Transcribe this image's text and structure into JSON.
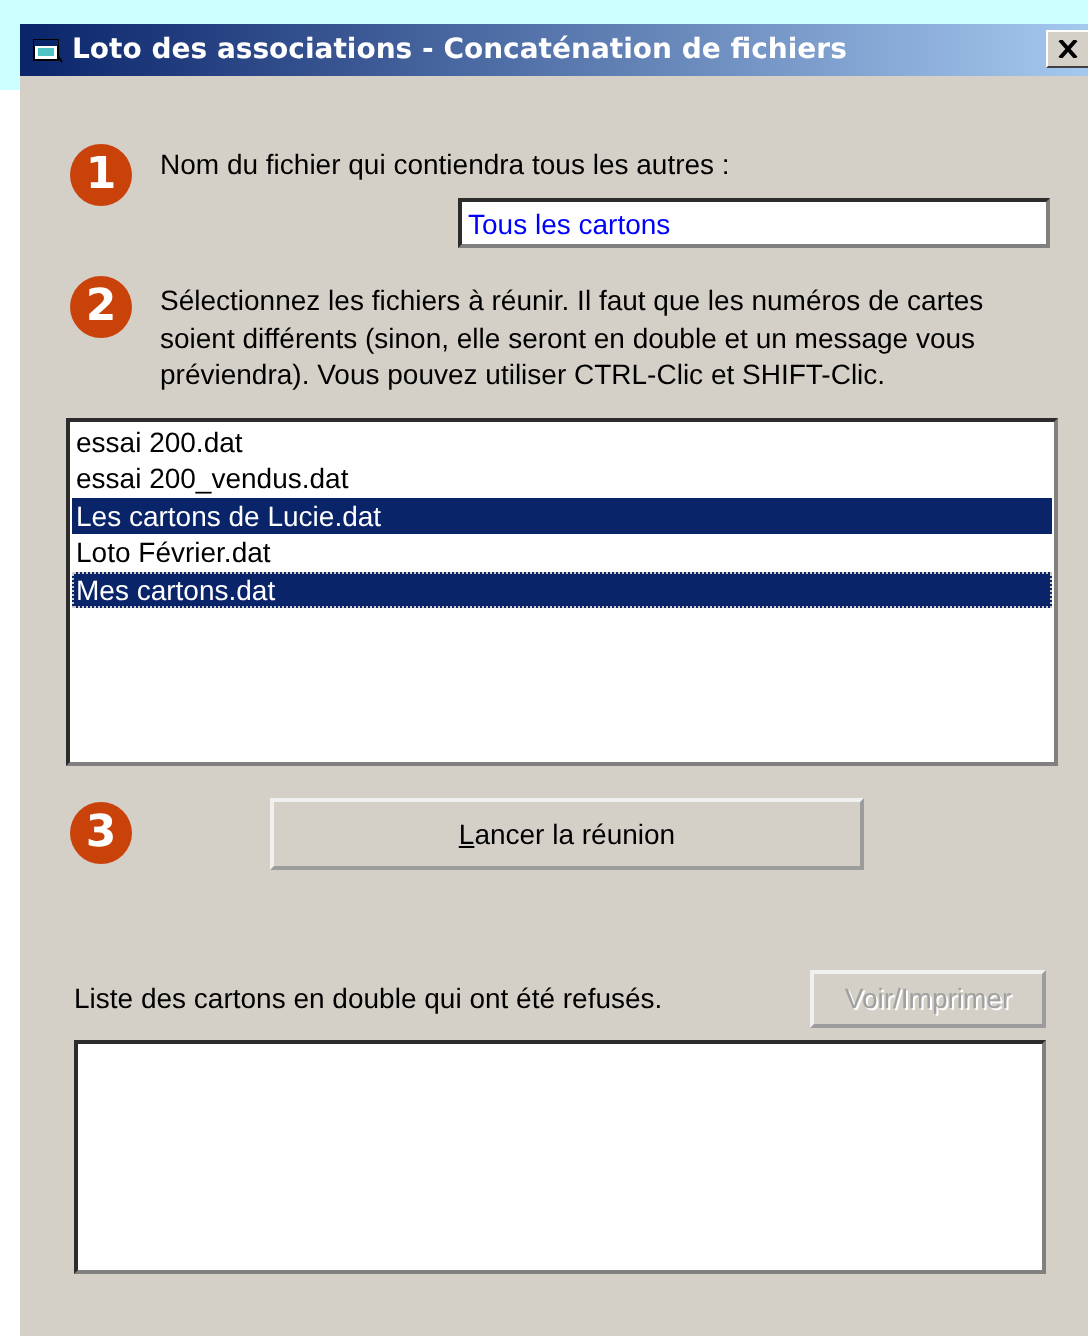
{
  "window": {
    "title": "Loto des associations - Concaténation de fichiers"
  },
  "steps": [
    {
      "number": "1",
      "label": "Nom du fichier qui contiendra tous les autres :"
    },
    {
      "number": "2",
      "label": "Sélectionnez les fichiers à réunir. Il faut que les numéros de cartes soient différents (sinon, elle seront en double et un message vous préviendra). Vous pouvez utiliser CTRL-Clic et SHIFT-Clic."
    },
    {
      "number": "3"
    }
  ],
  "output_name_field": {
    "value": "Tous les cartons"
  },
  "file_list": {
    "items": [
      {
        "label": "essai 200.dat",
        "selected": false,
        "focused": false
      },
      {
        "label": "essai 200_vendus.dat",
        "selected": false,
        "focused": false
      },
      {
        "label": "Les cartons de Lucie.dat",
        "selected": true,
        "focused": false
      },
      {
        "label": "Loto Février.dat",
        "selected": false,
        "focused": false
      },
      {
        "label": "Mes cartons.dat",
        "selected": true,
        "focused": true
      }
    ]
  },
  "run_button": {
    "label": "Lancer la réunion",
    "shortcut_underlined": true
  },
  "rejected": {
    "label": "Liste des cartons en double qui ont été refusés.",
    "view_button": {
      "label": "Voir/Imprimer",
      "disabled": true
    }
  }
}
